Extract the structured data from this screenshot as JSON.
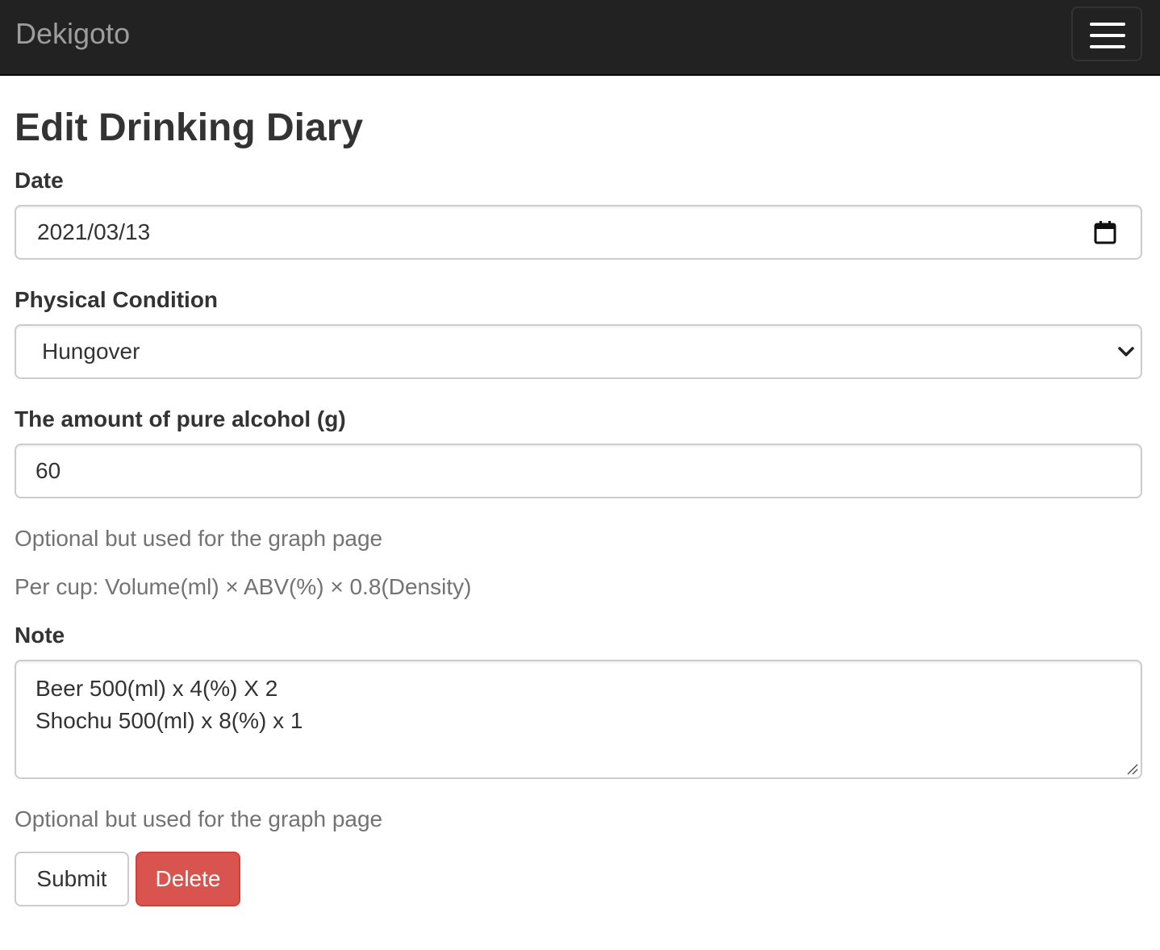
{
  "navbar": {
    "brand": "Dekigoto",
    "menu_icon": "hamburger-menu-icon"
  },
  "page": {
    "title": "Edit Drinking Diary"
  },
  "form": {
    "date": {
      "label": "Date",
      "value": "2021/03/13",
      "icon": "calendar-icon"
    },
    "condition": {
      "label": "Physical Condition",
      "selected": "Hungover",
      "icon": "chevron-down-icon"
    },
    "alcohol": {
      "label": "The amount of pure alcohol (g)",
      "value": "60",
      "help_1": "Optional but used for the graph page",
      "help_2": "Per cup: Volume(ml) × ABV(%) × 0.8(Density)"
    },
    "note": {
      "label": "Note",
      "lines": [
        "Beer 500(ml) x 4(%) X 2",
        "Shochu 500(ml) x 8(%) x 1"
      ],
      "help": "Optional but used for the graph page"
    },
    "submit_label": "Submit",
    "delete_label": "Delete"
  },
  "colors": {
    "navbar_bg": "#222222",
    "brand_text": "#9d9d9d",
    "danger": "#d9534f",
    "help_text": "#737373"
  }
}
